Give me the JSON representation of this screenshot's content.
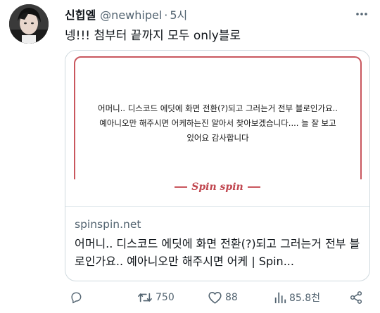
{
  "tweet": {
    "author_name": "신힙엘",
    "author_handle": "@newhipel",
    "separator": "·",
    "time": "5시",
    "text": "넹!!! 첨부터 끝까지 모두 only블로"
  },
  "card": {
    "image_text": "어머니.. 디스코드 에딧에 화면 전환(?)되고 그러는거 전부 블로인가요.. 예아니오만 해주시면 어케하는진 알아서 찾아보겠습니다.... 늘 잘 보고 있어요 감사합니다",
    "brand": "Spin spin",
    "domain": "spinspin.net",
    "description": "어머니.. 디스코드 에딧에 화면 전환(?)되고 그러는거 전부 블로인가요.. 예아니오만 해주시면 어케 | Spin..."
  },
  "actions": {
    "retweets": "750",
    "likes": "88",
    "views": "85.8천"
  },
  "icons": {
    "more": "more-icon",
    "reply": "reply-icon",
    "retweet": "retweet-icon",
    "like": "heart-icon",
    "views": "views-icon",
    "share": "share-icon"
  },
  "colors": {
    "accent_red": "#c9575e",
    "muted": "#536471",
    "text": "#0f1419"
  }
}
